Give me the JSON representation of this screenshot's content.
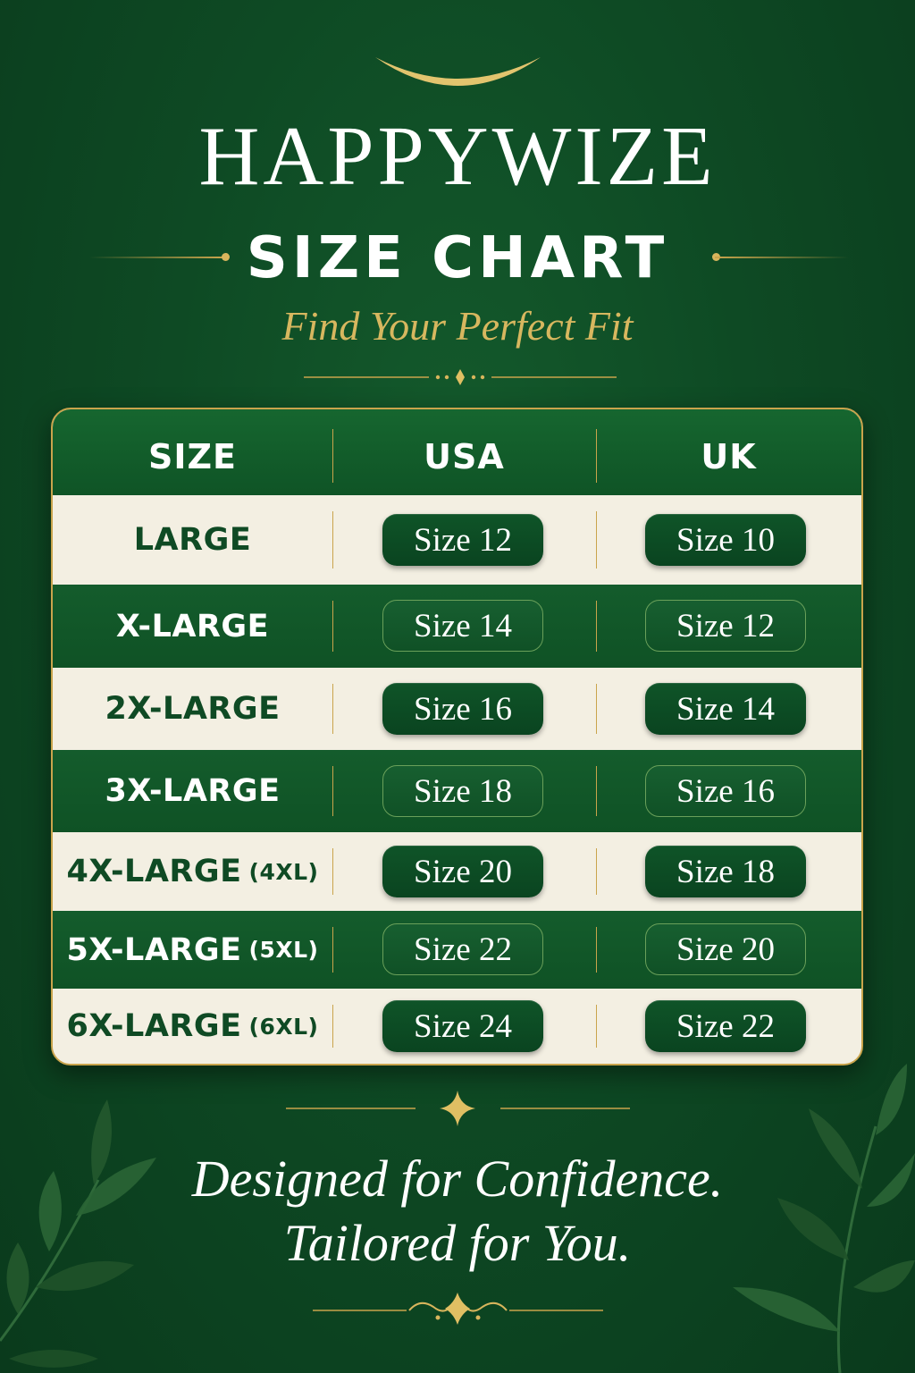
{
  "brand": "HAPPYWIZE",
  "subtitle": "SIZE CHART",
  "tagline": "Find Your Perfect Fit",
  "table": {
    "headers": [
      "SIZE",
      "USA",
      "UK"
    ],
    "rows": [
      {
        "size": "LARGE",
        "paren": "",
        "usa": "Size 12",
        "uk": "Size 10"
      },
      {
        "size": "X-LARGE",
        "paren": "",
        "usa": "Size 14",
        "uk": "Size 12"
      },
      {
        "size": "2X-LARGE",
        "paren": "",
        "usa": "Size 16",
        "uk": "Size 14"
      },
      {
        "size": "3X-LARGE",
        "paren": "",
        "usa": "Size 18",
        "uk": "Size 16"
      },
      {
        "size": "4X-LARGE",
        "paren": "(4XL)",
        "usa": "Size 20",
        "uk": "Size 18"
      },
      {
        "size": "5X-LARGE",
        "paren": "(5XL)",
        "usa": "Size 22",
        "uk": "Size 20"
      },
      {
        "size": "6X-LARGE",
        "paren": "(6XL)",
        "usa": "Size 24",
        "uk": "Size 22"
      }
    ]
  },
  "closing": {
    "line1": "Designed for Confidence.",
    "line2": "Tailored for You."
  },
  "colors": {
    "background": "#0e4a24",
    "gold": "#c9a44c",
    "cream": "#f3efe2",
    "row_dark": "#145c2c"
  },
  "decorations": [
    "crescent-arc",
    "gold-rule-ornament",
    "diamond-star-ornament",
    "scroll-flourish",
    "leaf-branch"
  ]
}
